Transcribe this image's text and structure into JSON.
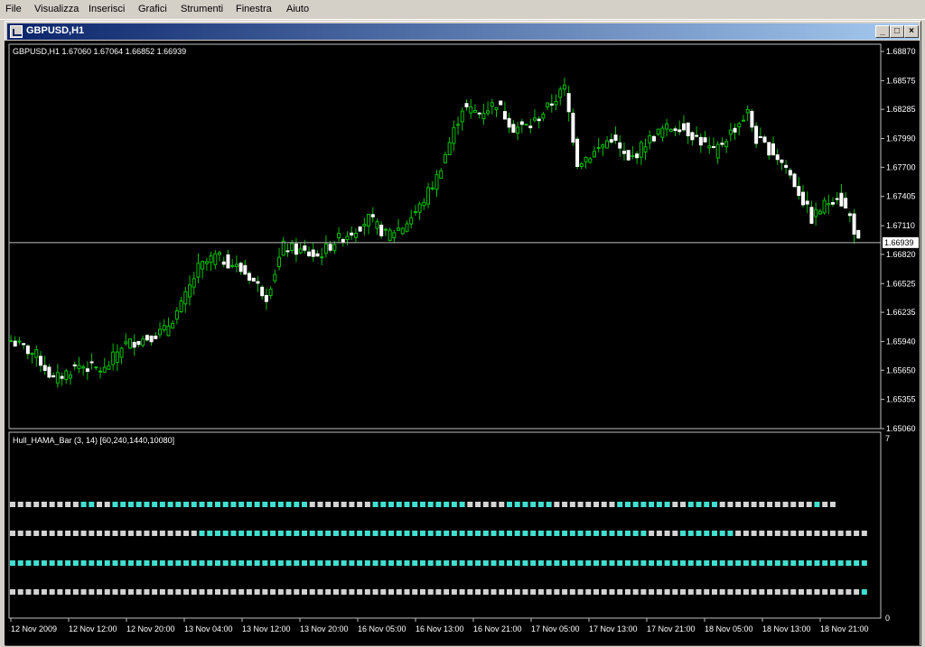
{
  "menu": [
    "File",
    "Visualizza",
    "Inserisci",
    "Grafici",
    "Strumenti",
    "Finestra",
    "Aiuto"
  ],
  "window": {
    "title": "GBPUSD,H1",
    "buttons": {
      "minimize": "_",
      "restore": "□",
      "close": "×"
    }
  },
  "chart_data": {
    "type": "candlestick",
    "symbol": "GBPUSD",
    "timeframe": "H1",
    "header": "GBPUSD,H1  1.67060 1.67064 1.66852 1.66939",
    "ohlc_last": {
      "open": 1.6706,
      "high": 1.67064,
      "low": 1.66852,
      "close": 1.66939
    },
    "current_price": 1.66939,
    "current_price_label": "1.66939",
    "ylim": [
      1.6506,
      1.6887
    ],
    "y_ticks": [
      1.6887,
      1.68575,
      1.68285,
      1.6799,
      1.677,
      1.67405,
      1.6711,
      1.6682,
      1.66525,
      1.66235,
      1.6594,
      1.6565,
      1.65355,
      1.6506
    ],
    "y_tick_labels": [
      "1.68870",
      "1.68575",
      "1.68285",
      "1.67990",
      "1.67700",
      "1.67405",
      "1.67110",
      "1.66820",
      "1.66525",
      "1.66235",
      "1.65940",
      "1.65650",
      "1.65355",
      "1.65060"
    ],
    "x_tick_labels": [
      "12 Nov 2009",
      "12 Nov 12:00",
      "12 Nov 20:00",
      "13 Nov 04:00",
      "13 Nov 12:00",
      "13 Nov 20:00",
      "16 Nov 05:00",
      "16 Nov 13:00",
      "16 Nov 21:00",
      "17 Nov 05:00",
      "17 Nov 13:00",
      "17 Nov 21:00",
      "18 Nov 05:00",
      "18 Nov 13:00",
      "18 Nov 21:00"
    ],
    "close_path": [
      [
        0,
        1.6595
      ],
      [
        6,
        1.658
      ],
      [
        10,
        1.6555
      ],
      [
        16,
        1.657
      ],
      [
        22,
        1.6565
      ],
      [
        26,
        1.659
      ],
      [
        32,
        1.6598
      ],
      [
        36,
        1.6605
      ],
      [
        40,
        1.663
      ],
      [
        44,
        1.6668
      ],
      [
        48,
        1.668
      ],
      [
        52,
        1.6672
      ],
      [
        56,
        1.666
      ],
      [
        60,
        1.664
      ],
      [
        64,
        1.669
      ],
      [
        68,
        1.6685
      ],
      [
        72,
        1.668
      ],
      [
        76,
        1.6695
      ],
      [
        80,
        1.6705
      ],
      [
        84,
        1.6718
      ],
      [
        88,
        1.6702
      ],
      [
        92,
        1.671
      ],
      [
        96,
        1.673
      ],
      [
        100,
        1.676
      ],
      [
        103,
        1.6795
      ],
      [
        106,
        1.683
      ],
      [
        110,
        1.6825
      ],
      [
        114,
        1.6835
      ],
      [
        118,
        1.681
      ],
      [
        122,
        1.6812
      ],
      [
        126,
        1.683
      ],
      [
        130,
        1.685
      ],
      [
        133,
        1.6775
      ],
      [
        137,
        1.6785
      ],
      [
        141,
        1.68
      ],
      [
        145,
        1.6775
      ],
      [
        149,
        1.6795
      ],
      [
        153,
        1.6808
      ],
      [
        157,
        1.6812
      ],
      [
        161,
        1.68
      ],
      [
        165,
        1.6785
      ],
      [
        169,
        1.6805
      ],
      [
        173,
        1.6825
      ],
      [
        175,
        1.6798
      ],
      [
        179,
        1.6785
      ],
      [
        182,
        1.677
      ],
      [
        185,
        1.6745
      ],
      [
        188,
        1.6718
      ],
      [
        191,
        1.6732
      ],
      [
        194,
        1.6742
      ],
      [
        197,
        1.672
      ],
      [
        199,
        1.6694
      ]
    ],
    "indicator": {
      "label": "Hull_HAMA_Bar (3, 14) [60,240,1440,10080]",
      "name": "Hull_HAMA_Bar",
      "periods": [
        3,
        14
      ],
      "timeframes": [
        60,
        240,
        1440,
        10080
      ],
      "ylim": [
        0,
        7
      ],
      "y_tick_labels": [
        "7",
        "0"
      ],
      "colors": {
        "up": "#40e0d0",
        "down": "#d3d3d3"
      },
      "rows": [
        {
          "timeframe": 60,
          "runs": [
            [
              "down",
              9
            ],
            [
              "up",
              2
            ],
            [
              "down",
              2
            ],
            [
              "up",
              25
            ],
            [
              "down",
              8
            ],
            [
              "up",
              12
            ],
            [
              "down",
              5
            ],
            [
              "up",
              6
            ],
            [
              "down",
              8
            ],
            [
              "up",
              7
            ],
            [
              "down",
              2
            ],
            [
              "up",
              4
            ],
            [
              "down",
              12
            ],
            [
              "up",
              1
            ],
            [
              "down",
              2
            ]
          ]
        },
        {
          "timeframe": 240,
          "runs": [
            [
              "down",
              24
            ],
            [
              "up",
              57
            ],
            [
              "down",
              4
            ],
            [
              "up",
              7
            ],
            [
              "down",
              17
            ]
          ]
        },
        {
          "timeframe": 1440,
          "runs": [
            [
              "up",
              109
            ]
          ]
        },
        {
          "timeframe": 10080,
          "runs": [
            [
              "down",
              108
            ],
            [
              "up",
              1
            ]
          ]
        }
      ]
    }
  }
}
